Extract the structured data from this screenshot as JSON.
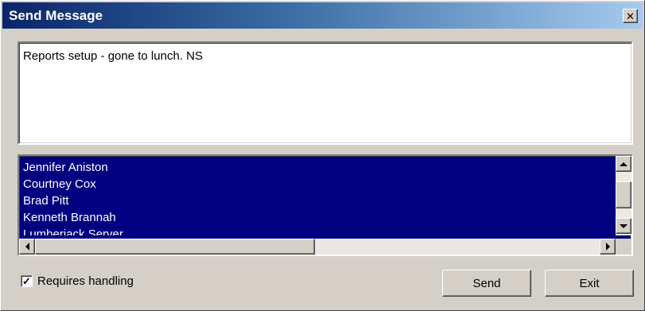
{
  "window": {
    "title": "Send Message",
    "close_glyph": "✕"
  },
  "message": {
    "text": "Reports setup - gone to lunch. NS"
  },
  "recipients": {
    "items": [
      "Jennifer Aniston",
      "Courtney Cox",
      "Brad Pitt",
      "Kenneth Brannah",
      "Lumberjack Server"
    ],
    "selection_color": "#000080"
  },
  "requires_handling": {
    "label": "Requires handling",
    "checked_glyph": "✓"
  },
  "buttons": {
    "send_label": "Send",
    "exit_label": "Exit"
  }
}
